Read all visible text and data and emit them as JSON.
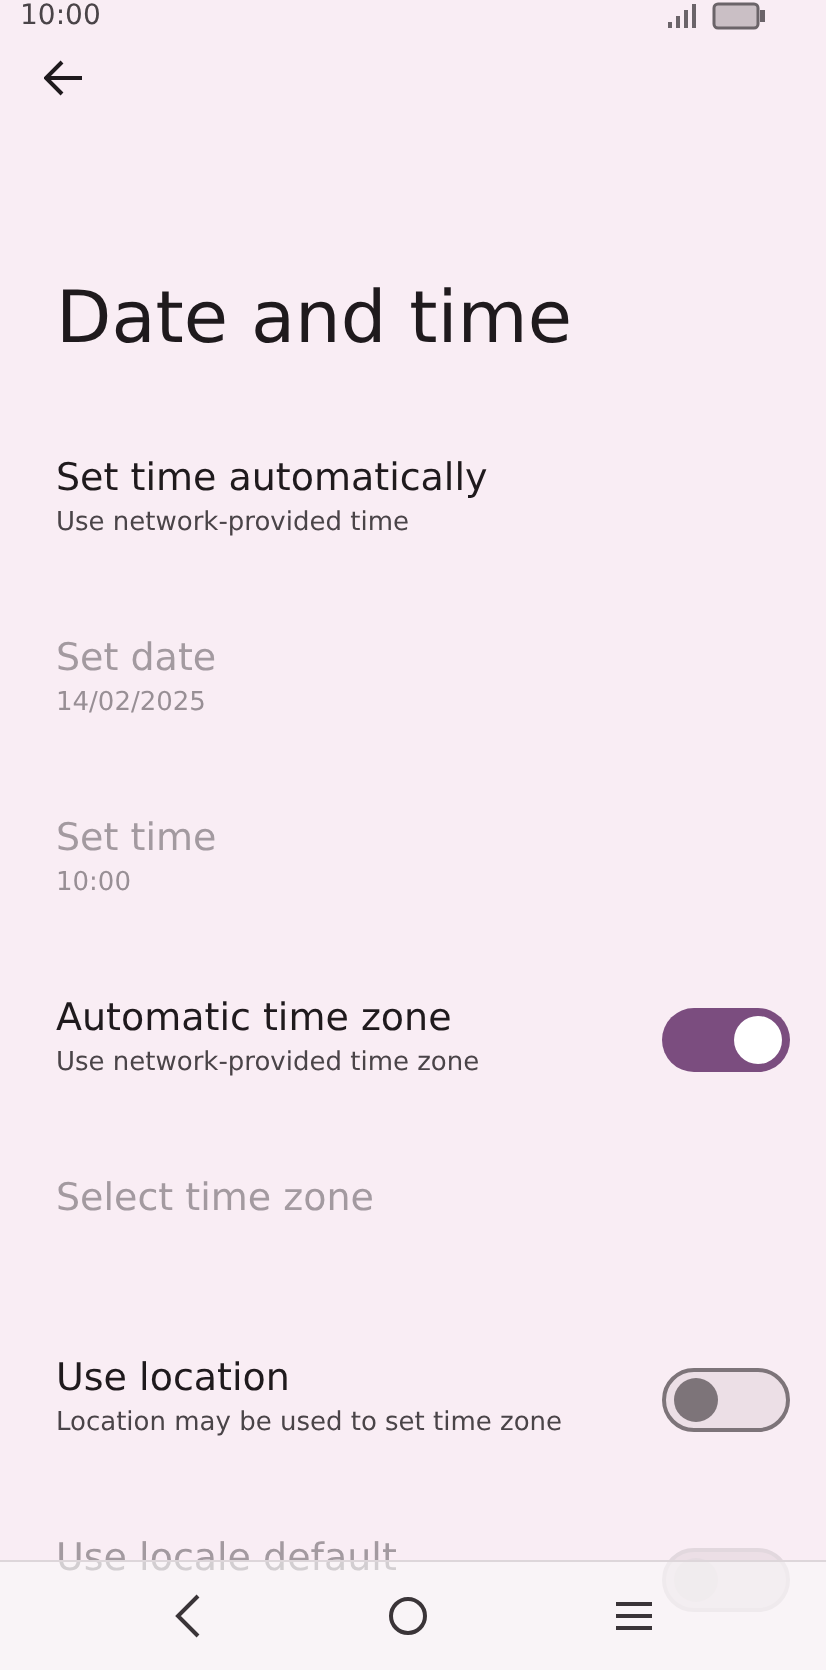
{
  "status_bar": {
    "time": "10:00"
  },
  "title": "Date and time",
  "items": [
    {
      "kind": "plain",
      "title": "Set time automatically",
      "subtitle": "Use network-provided time",
      "disabled": false
    },
    {
      "kind": "plain",
      "title": "Set date",
      "subtitle": "14/02/2025",
      "disabled": true
    },
    {
      "kind": "plain",
      "title": "Set time",
      "subtitle": "10:00",
      "disabled": true
    },
    {
      "kind": "switch",
      "title": "Automatic time zone",
      "subtitle": "Use network-provided time zone",
      "disabled": false,
      "on": true
    },
    {
      "kind": "plain",
      "title": "Select time zone",
      "disabled": true
    },
    {
      "kind": "switch",
      "title": "Use location",
      "subtitle": "Location may be used to set time zone",
      "disabled": false,
      "on": false
    },
    {
      "kind": "switch",
      "title": "Use locale default",
      "disabled": true,
      "on": false
    }
  ]
}
